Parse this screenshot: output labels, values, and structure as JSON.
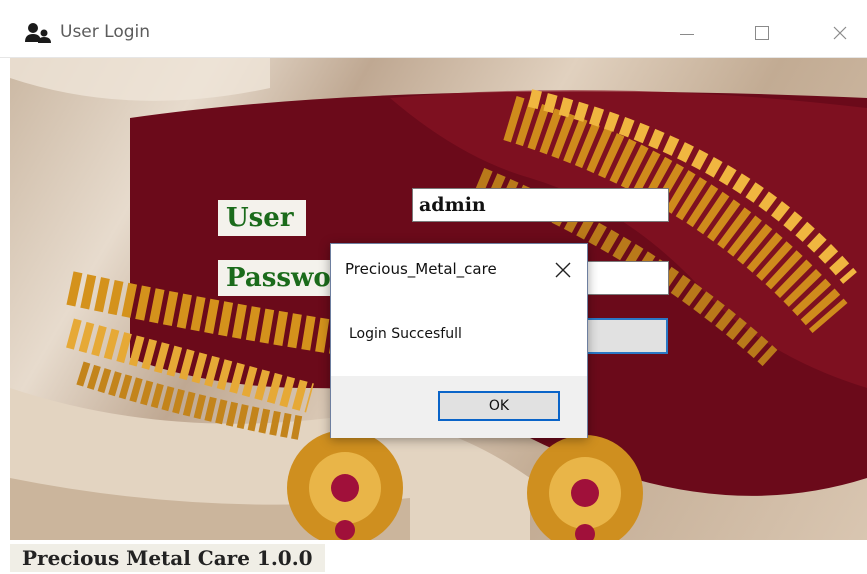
{
  "window": {
    "title": "User Login",
    "icon": "users-icon"
  },
  "form": {
    "user_label": "User",
    "password_label": "Passwo",
    "user_value": "admin",
    "password_value": "",
    "login_button_label": ""
  },
  "dialog": {
    "title": "Precious_Metal_care",
    "message": "Login Succesfull",
    "ok_label": "OK"
  },
  "status": {
    "text": "Precious Metal Care  1.0.0"
  },
  "colors": {
    "label_text": "#1b6b1b",
    "focus_border": "#0a64c8",
    "velvet": "#6b0a1a",
    "gold": "#d4921c"
  }
}
